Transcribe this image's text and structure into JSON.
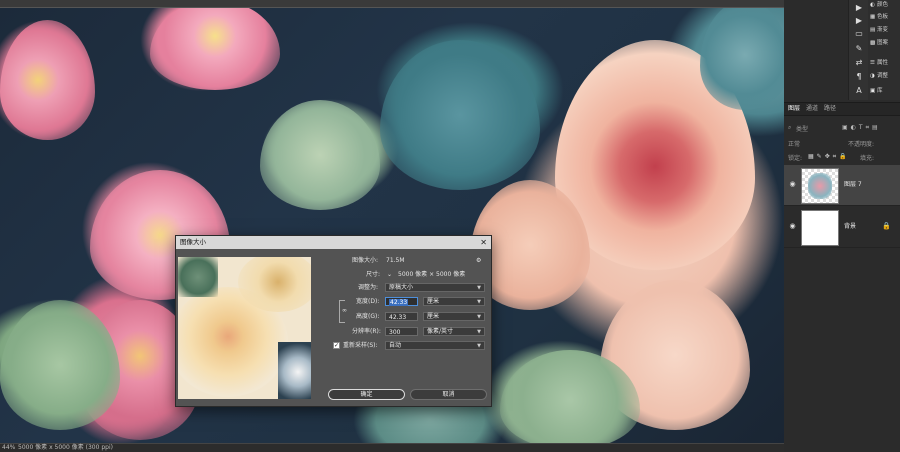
{
  "canvas": {
    "statusbar": {
      "zoom": "44%",
      "doc_info": "5000 像素 x 5000 像素 (300 ppi)"
    }
  },
  "right_dock": {
    "mini_panel": [
      "颜色",
      "色板",
      "渐变",
      "图案",
      "属性",
      "调整",
      "库"
    ]
  },
  "layers_panel": {
    "tabs": [
      "图层",
      "通道",
      "路径"
    ],
    "kind_filter": "类型",
    "blend_mode": "正常",
    "opacity_label": "不透明度:",
    "lock_label": "锁定:",
    "fill_label": "填充:",
    "layers": [
      {
        "name": "图层 7",
        "selected": true
      },
      {
        "name": "背景",
        "locked": true
      }
    ]
  },
  "dialog": {
    "title": "图像大小",
    "image_size_label": "图像大小:",
    "image_size_value": "71.5M",
    "dimensions_label": "尺寸:",
    "dimensions_value": "5000 像素 × 5000 像素",
    "fit_to_label": "调整为:",
    "fit_to_value": "原稿大小",
    "width_label": "宽度(D):",
    "width_value": "42.33",
    "width_unit": "厘米",
    "height_label": "高度(G):",
    "height_value": "42.33",
    "height_unit": "厘米",
    "resolution_label": "分辨率(R):",
    "resolution_value": "300",
    "resolution_unit": "像素/英寸",
    "resample_label": "重新采样(S):",
    "resample_checked": true,
    "resample_value": "自动",
    "ok_label": "确定",
    "cancel_label": "取消"
  }
}
